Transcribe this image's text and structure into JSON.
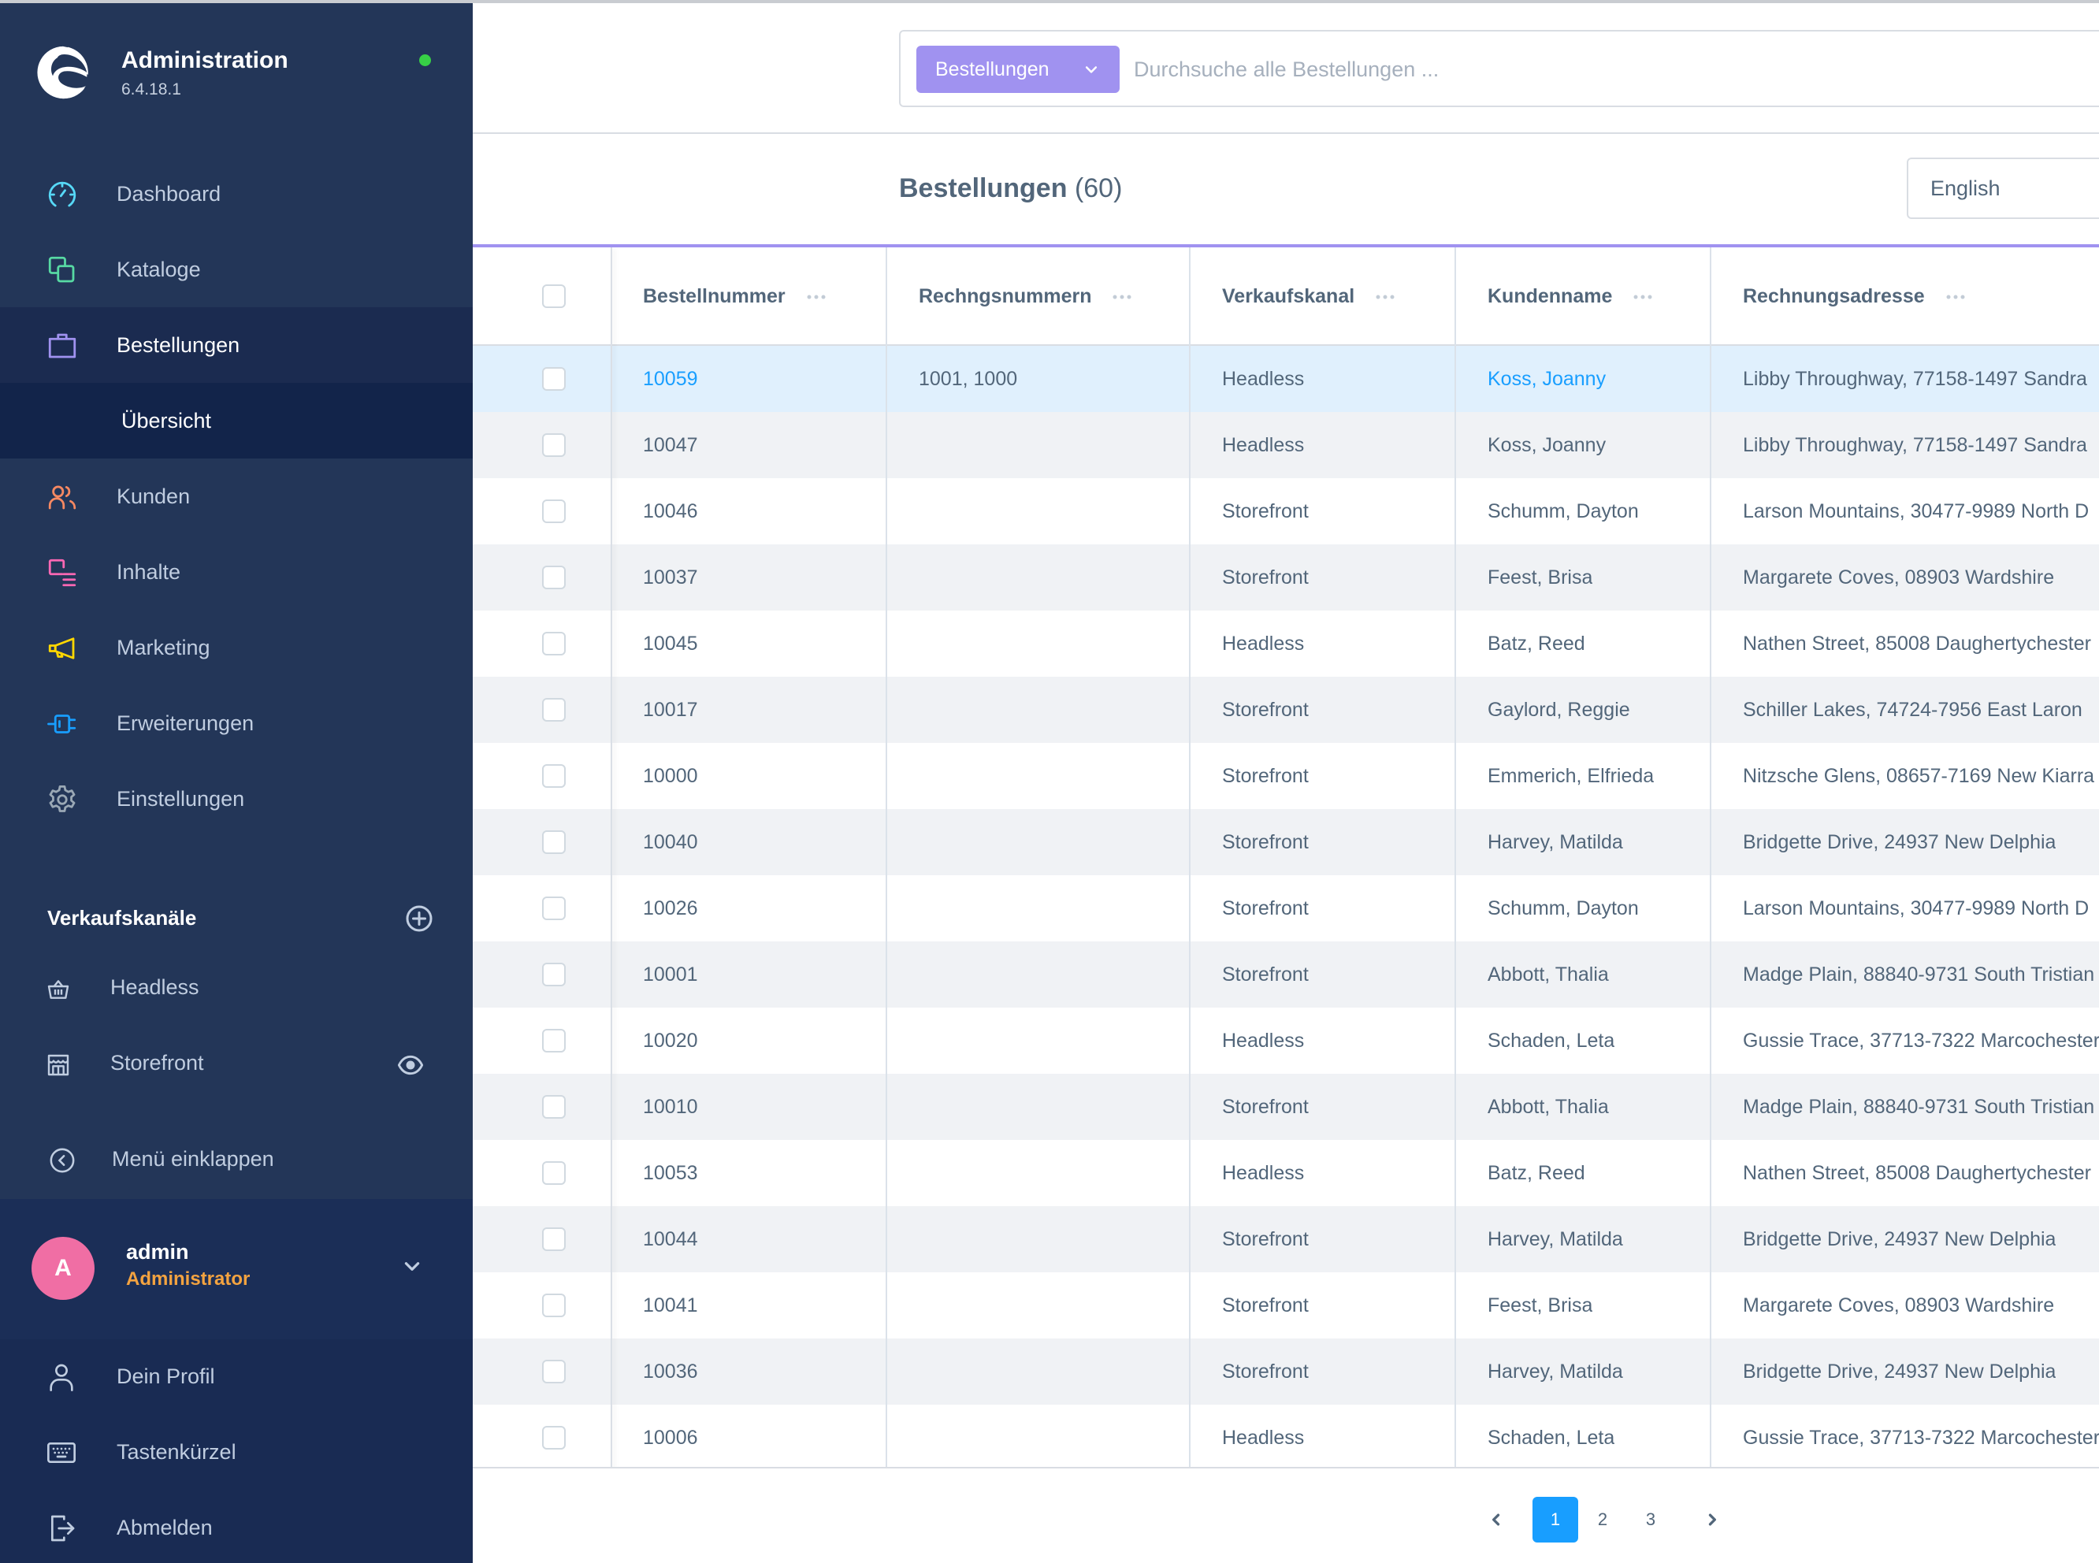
{
  "app": {
    "title": "Administration",
    "version": "6.4.18.1",
    "status_color": "#37d046"
  },
  "sidebar": {
    "items": [
      {
        "label": "Dashboard",
        "icon": "gauge-icon",
        "color": "#57d9f7"
      },
      {
        "label": "Kataloge",
        "icon": "catalog-icon",
        "color": "#57d9a3"
      },
      {
        "label": "Bestellungen",
        "icon": "shopping-bag-icon",
        "color": "#a092f0",
        "active": true
      },
      {
        "label": "Kunden",
        "icon": "users-icon",
        "color": "#f88962"
      },
      {
        "label": "Inhalte",
        "icon": "content-icon",
        "color": "#ff68b4"
      },
      {
        "label": "Marketing",
        "icon": "megaphone-icon",
        "color": "#ffd700"
      },
      {
        "label": "Erweiterungen",
        "icon": "plug-icon",
        "color": "#189eff"
      },
      {
        "label": "Einstellungen",
        "icon": "gear-icon",
        "color": "#9aa8b5"
      }
    ],
    "subitem": {
      "label": "Übersicht"
    },
    "channels": {
      "heading": "Verkaufskanäle",
      "items": [
        {
          "label": "Headless",
          "icon": "basket-icon"
        },
        {
          "label": "Storefront",
          "icon": "storefront-icon",
          "has_preview": true
        }
      ]
    },
    "collapse_label": "Menü einklappen",
    "user": {
      "initial": "A",
      "name": "admin",
      "role": "Administrator",
      "avatar_color": "#f06ea4"
    },
    "user_menu": [
      {
        "label": "Dein Profil",
        "icon": "user-icon"
      },
      {
        "label": "Tastenkürzel",
        "icon": "keyboard-icon"
      },
      {
        "label": "Abmelden",
        "icon": "logout-icon"
      }
    ]
  },
  "search": {
    "type_label": "Bestellungen",
    "placeholder": "Durchsuche alle Bestellungen ...",
    "value": ""
  },
  "page": {
    "title": "Bestellungen",
    "count": "(60)",
    "language": "English"
  },
  "table": {
    "columns": [
      "Bestellnummer",
      "Rechngsnummern",
      "Verkaufskanal",
      "Kundenname",
      "Rechnungsadresse"
    ],
    "rows": [
      {
        "order": "10059",
        "invoice": "1001, 1000",
        "channel": "Headless",
        "customer": "Koss, Joanny",
        "address": "Libby Throughway, 77158-1497 Sandra"
      },
      {
        "order": "10047",
        "invoice": "",
        "channel": "Headless",
        "customer": "Koss, Joanny",
        "address": "Libby Throughway, 77158-1497 Sandra"
      },
      {
        "order": "10046",
        "invoice": "",
        "channel": "Storefront",
        "customer": "Schumm, Dayton",
        "address": "Larson Mountains, 30477-9989 North D"
      },
      {
        "order": "10037",
        "invoice": "",
        "channel": "Storefront",
        "customer": "Feest, Brisa",
        "address": "Margarete Coves, 08903 Wardshire"
      },
      {
        "order": "10045",
        "invoice": "",
        "channel": "Headless",
        "customer": "Batz, Reed",
        "address": "Nathen Street, 85008 Daughertychester"
      },
      {
        "order": "10017",
        "invoice": "",
        "channel": "Storefront",
        "customer": "Gaylord, Reggie",
        "address": "Schiller Lakes, 74724-7956 East Laron"
      },
      {
        "order": "10000",
        "invoice": "",
        "channel": "Storefront",
        "customer": "Emmerich, Elfrieda",
        "address": "Nitzsche Glens, 08657-7169 New Kiarra"
      },
      {
        "order": "10040",
        "invoice": "",
        "channel": "Storefront",
        "customer": "Harvey, Matilda",
        "address": "Bridgette Drive, 24937 New Delphia"
      },
      {
        "order": "10026",
        "invoice": "",
        "channel": "Storefront",
        "customer": "Schumm, Dayton",
        "address": "Larson Mountains, 30477-9989 North D"
      },
      {
        "order": "10001",
        "invoice": "",
        "channel": "Storefront",
        "customer": "Abbott, Thalia",
        "address": "Madge Plain, 88840-9731 South Tristian"
      },
      {
        "order": "10020",
        "invoice": "",
        "channel": "Headless",
        "customer": "Schaden, Leta",
        "address": "Gussie Trace, 37713-7322 Marcochester"
      },
      {
        "order": "10010",
        "invoice": "",
        "channel": "Storefront",
        "customer": "Abbott, Thalia",
        "address": "Madge Plain, 88840-9731 South Tristian"
      },
      {
        "order": "10053",
        "invoice": "",
        "channel": "Headless",
        "customer": "Batz, Reed",
        "address": "Nathen Street, 85008 Daughertychester"
      },
      {
        "order": "10044",
        "invoice": "",
        "channel": "Storefront",
        "customer": "Harvey, Matilda",
        "address": "Bridgette Drive, 24937 New Delphia"
      },
      {
        "order": "10041",
        "invoice": "",
        "channel": "Storefront",
        "customer": "Feest, Brisa",
        "address": "Margarete Coves, 08903 Wardshire"
      },
      {
        "order": "10036",
        "invoice": "",
        "channel": "Storefront",
        "customer": "Harvey, Matilda",
        "address": "Bridgette Drive, 24937 New Delphia"
      },
      {
        "order": "10006",
        "invoice": "",
        "channel": "Headless",
        "customer": "Schaden, Leta",
        "address": "Gussie Trace, 37713-7322 Marcochester"
      }
    ],
    "highlighted_row": 0
  },
  "pagination": {
    "pages": [
      "1",
      "2",
      "3"
    ],
    "current": "1"
  },
  "colors": {
    "sidebar_bg": "#233658",
    "accent_purple": "#a092f0",
    "link_blue": "#189eff",
    "row_highlight": "#e0f0fd"
  }
}
